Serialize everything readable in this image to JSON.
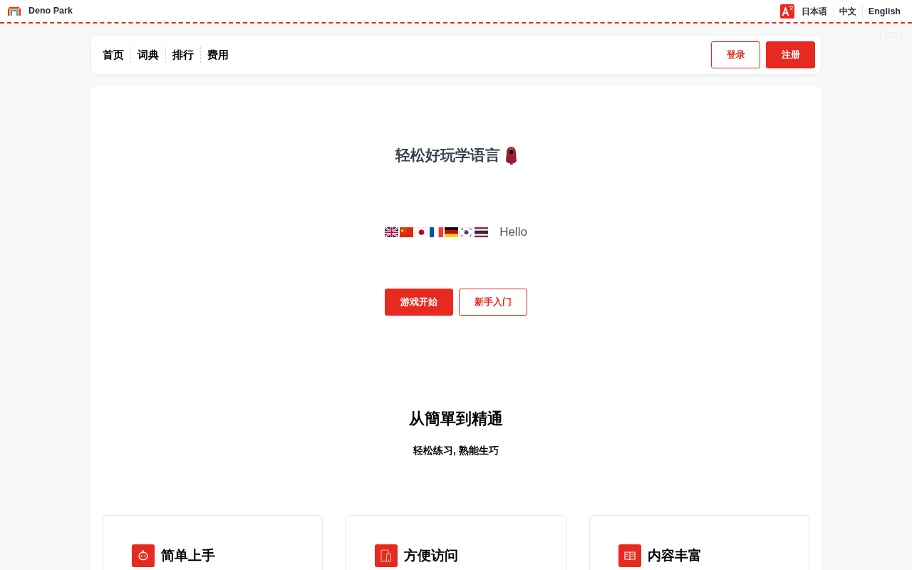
{
  "top_bar": {
    "brand": "Deno Park",
    "languages": [
      "日本语",
      "中文",
      "English"
    ]
  },
  "nav": {
    "links": [
      "首页",
      "词典",
      "排行",
      "费用"
    ],
    "buttons": [
      {
        "label": "登录",
        "kind": "outline"
      },
      {
        "label": "注册",
        "kind": "filled"
      }
    ]
  },
  "hero": {
    "title": "轻松好玩学语言",
    "flags": [
      {
        "kind": "britain"
      },
      {
        "kind": "china"
      },
      {
        "kind": "japan"
      },
      {
        "kind": "france"
      },
      {
        "kind": "germany"
      },
      {
        "kind": "korea"
      },
      {
        "kind": "thailand"
      }
    ],
    "greeting": "Hello",
    "buttons": [
      {
        "label": "游戏开始",
        "kind": "filled"
      },
      {
        "label": "新手入门",
        "kind": "outline"
      }
    ]
  },
  "features_intro": {
    "heading": "从簡單到精通",
    "subheading": "轻松练习, 熟能生巧"
  },
  "features": [
    {
      "title": "简单上手",
      "kind": "robot"
    },
    {
      "title": "方便访问",
      "kind": "devices"
    },
    {
      "title": "内容丰富",
      "kind": "book"
    }
  ]
}
